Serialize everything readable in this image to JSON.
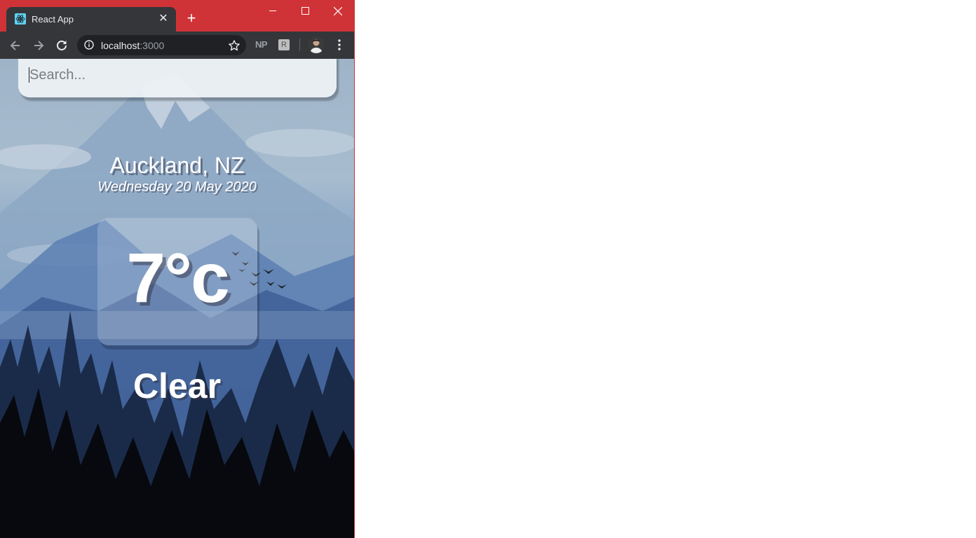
{
  "browser": {
    "tab": {
      "title": "React App",
      "favicon": "react-logo-icon",
      "close_icon": "close-icon"
    },
    "new_tab_icon": "plus-icon",
    "window_controls": [
      "minimize-icon",
      "maximize-icon",
      "close-icon"
    ],
    "address_bar": {
      "host": "localhost",
      "port": ":3000",
      "security_icon": "info-icon",
      "bookmark_icon": "star-icon"
    },
    "extensions": {
      "np_label": "NP",
      "r_label": "R"
    },
    "colors": {
      "titlebar": "#d03337",
      "toolbar": "#35363a",
      "omnibox": "#202124"
    }
  },
  "app": {
    "search": {
      "placeholder": "Search...",
      "value": ""
    },
    "location": "Auckland, NZ",
    "date": "Wednesday 20 May 2020",
    "temperature": "7°c",
    "condition": "Clear"
  }
}
